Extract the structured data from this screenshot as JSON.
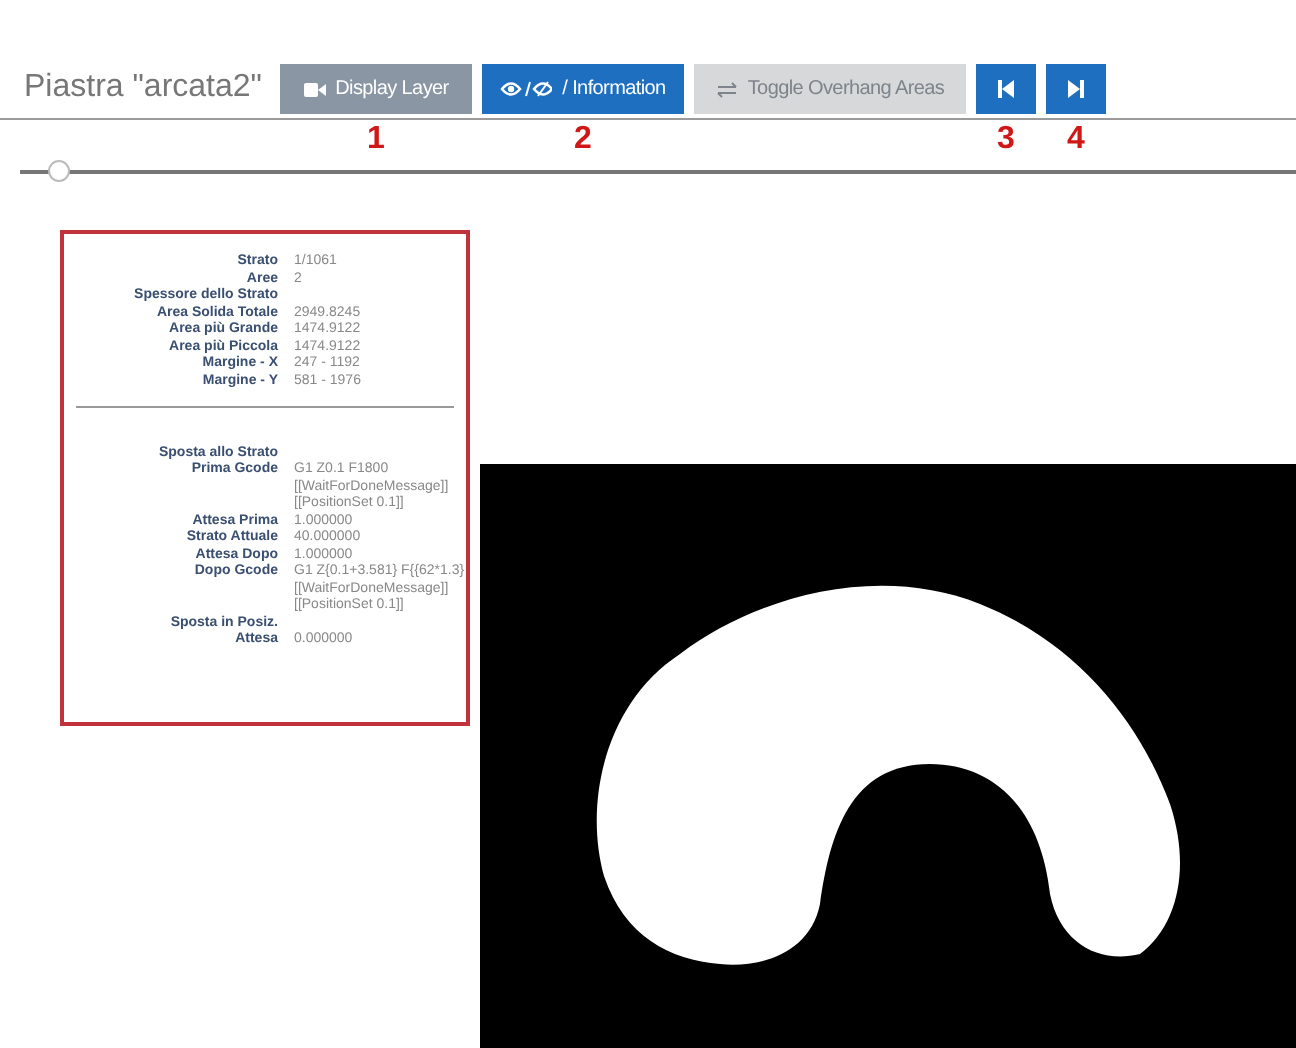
{
  "plate": {
    "title": "Piastra \"arcata2\""
  },
  "toolbar": [
    {
      "kind": "display",
      "label": "Display Layer",
      "disabled": false,
      "marker": "1"
    },
    {
      "kind": "info",
      "label": "/ Information",
      "disabled": false,
      "marker": "2"
    },
    {
      "kind": "overhang",
      "label": "Toggle Overhang Areas",
      "disabled": true
    },
    {
      "kind": "first",
      "disabled": false,
      "marker": "3"
    },
    {
      "kind": "last",
      "disabled": false,
      "marker": "4"
    }
  ],
  "layer_slider": {
    "level": 0.03
  },
  "info_panel": {
    "sections": [
      [
        {
          "label": "Strato",
          "value": [
            "1/1061"
          ]
        },
        {
          "label": "Aree",
          "value": [
            "2"
          ]
        },
        {
          "label": "Spessore dello Strato"
        },
        {
          "label": "Area Solida Totale",
          "value": [
            "2949.8245"
          ]
        },
        {
          "label": "Area più Grande",
          "value": [
            "1474.9122"
          ]
        },
        {
          "label": "Area più Piccola",
          "value": [
            "1474.9122"
          ]
        },
        {
          "label": "Margine - X",
          "value": [
            "247 - 1192"
          ]
        },
        {
          "label": "Margine - Y",
          "value": [
            "581 - 1976"
          ]
        }
      ],
      [
        {
          "label": "Sposta allo Strato"
        },
        {
          "label": "Prima Gcode",
          "value": [
            "G1 Z0.1 F1800",
            "[[WaitForDoneMessage]]",
            "[[PositionSet 0.1]]"
          ]
        },
        {
          "label": "Attesa Prima",
          "value": [
            "1.000000"
          ]
        },
        {
          "label": "Strato Attuale",
          "value": [
            "40.000000"
          ]
        },
        {
          "label": "Attesa Dopo",
          "value": [
            "1.000000"
          ]
        },
        {
          "label": "Dopo Gcode",
          "value": [
            "G1 Z{0.1+3.581} F{{62*1.3}",
            "[[WaitForDoneMessage]]",
            "[[PositionSet 0.1]]"
          ]
        },
        {
          "label": "Sposta in Posiz."
        },
        {
          "label": "Attesa",
          "value": [
            "0.000000"
          ]
        }
      ]
    ]
  }
}
